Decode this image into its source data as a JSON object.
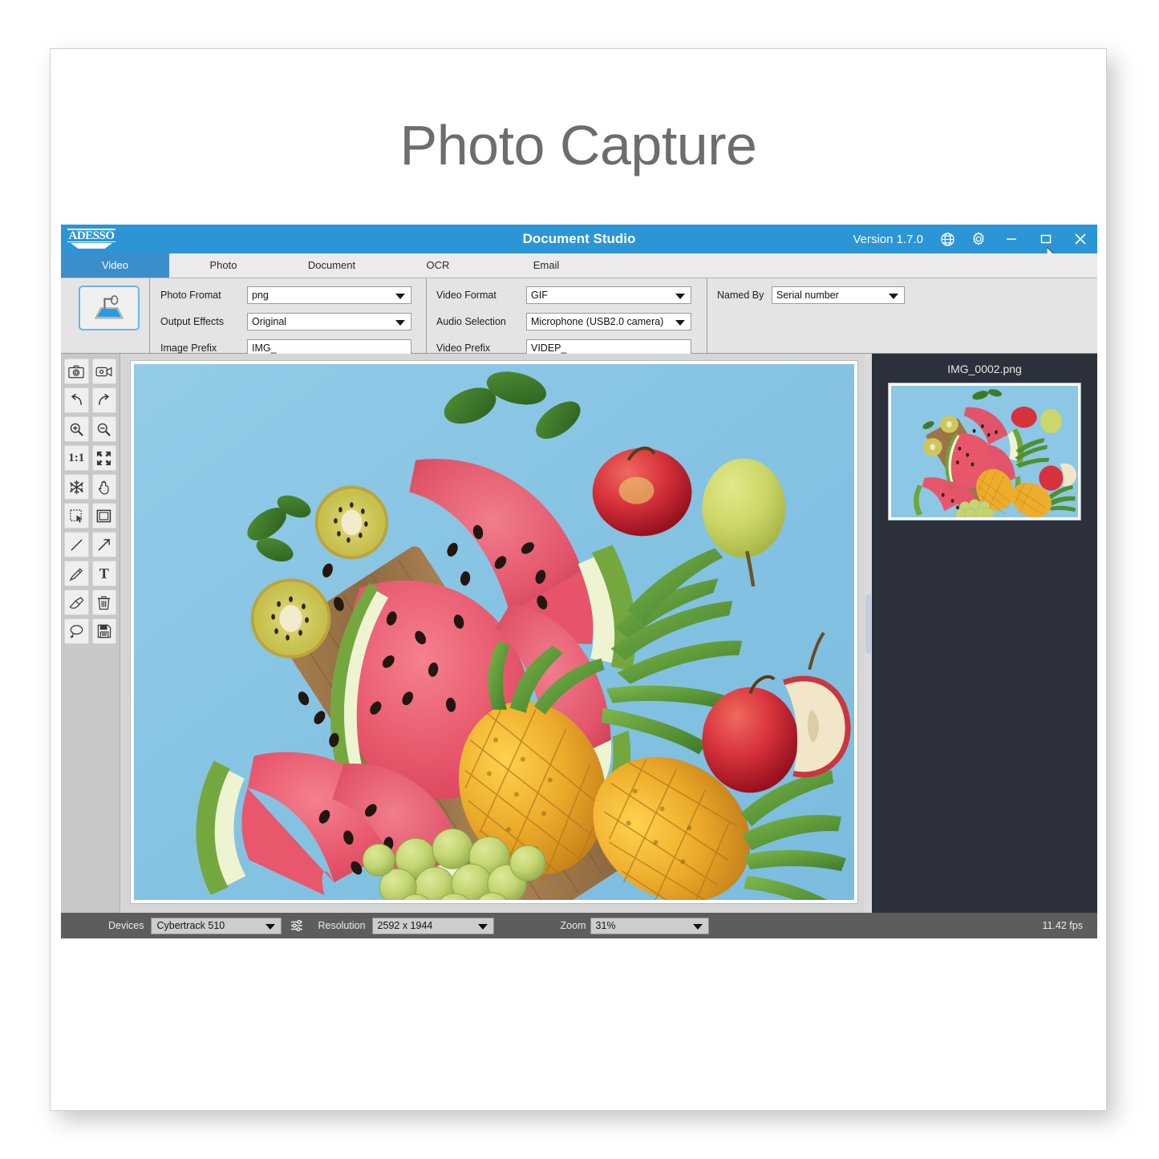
{
  "document": {
    "heading": "Photo Capture"
  },
  "window": {
    "brand": "ADESSO",
    "title": "Document Studio",
    "version": "Version 1.7.0",
    "icons": {
      "globe": "globe-icon",
      "gear": "gear-icon",
      "minimize": "minimize-icon",
      "maximize": "maximize-icon",
      "close": "close-icon"
    },
    "colors": {
      "titlebar": "#2b95d6",
      "active_tab": "#3c8ecb",
      "panel": "#e4e4e4",
      "thumb_panel": "#2b303b",
      "statusbar": "#5d5d5d"
    }
  },
  "tabs": [
    {
      "label": "Video",
      "active": true
    },
    {
      "label": "Photo",
      "active": false
    },
    {
      "label": "Document",
      "active": false
    },
    {
      "label": "OCR",
      "active": false
    },
    {
      "label": "Email",
      "active": false
    }
  ],
  "settings": {
    "photo_format": {
      "label": "Photo Fromat",
      "value": "png"
    },
    "output_effects": {
      "label": "Output Effects",
      "value": "Original"
    },
    "image_prefix": {
      "label": "Image Prefix",
      "value": "IMG_"
    },
    "video_format": {
      "label": "Video Format",
      "value": "GIF"
    },
    "audio_selection": {
      "label": "Audio Selection",
      "value": "Microphone (USB2.0 camera)"
    },
    "video_prefix": {
      "label": "Video Prefix",
      "value": "VIDEP_"
    },
    "named_by": {
      "label": "Named By",
      "value": "Serial number"
    },
    "device_button_icon": "scanner-stand-icon"
  },
  "toolbar": {
    "tools": [
      {
        "name": "capture-photo-icon",
        "glyph": "camera"
      },
      {
        "name": "record-video-icon",
        "glyph": "camcorder"
      },
      {
        "name": "undo-icon",
        "glyph": "undo"
      },
      {
        "name": "redo-icon",
        "glyph": "redo"
      },
      {
        "name": "zoom-in-icon",
        "glyph": "zoom-in"
      },
      {
        "name": "zoom-out-icon",
        "glyph": "zoom-out"
      },
      {
        "name": "actual-size-icon",
        "glyph": "1:1"
      },
      {
        "name": "fit-screen-icon",
        "glyph": "fit"
      },
      {
        "name": "freeze-icon",
        "glyph": "snowflake"
      },
      {
        "name": "pan-hand-icon",
        "glyph": "hand"
      },
      {
        "name": "marquee-select-icon",
        "glyph": "marquee"
      },
      {
        "name": "rectangle-shape-icon",
        "glyph": "square"
      },
      {
        "name": "line-tool-icon",
        "glyph": "line"
      },
      {
        "name": "arrow-tool-icon",
        "glyph": "arrow"
      },
      {
        "name": "pencil-tool-icon",
        "glyph": "pencil"
      },
      {
        "name": "text-tool-icon",
        "glyph": "T"
      },
      {
        "name": "eraser-tool-icon",
        "glyph": "eraser"
      },
      {
        "name": "delete-icon",
        "glyph": "trash"
      },
      {
        "name": "lasso-tool-icon",
        "glyph": "lasso"
      },
      {
        "name": "save-icon",
        "glyph": "floppy"
      }
    ]
  },
  "preview": {
    "subject": "overhead photo of sliced watermelon, kiwi, apples, pear, pineapples and green grapes on a wooden board over a light blue background"
  },
  "thumbnails": [
    {
      "filename": "IMG_0002.png"
    }
  ],
  "statusbar": {
    "devices_label": "Devices",
    "device_value": "Cybertrack 510",
    "settings_icon": "sliders-icon",
    "resolution_label": "Resolution",
    "resolution_value": "2592 x 1944",
    "zoom_label": "Zoom",
    "zoom_value": "31%",
    "fps": "11.42 fps"
  }
}
